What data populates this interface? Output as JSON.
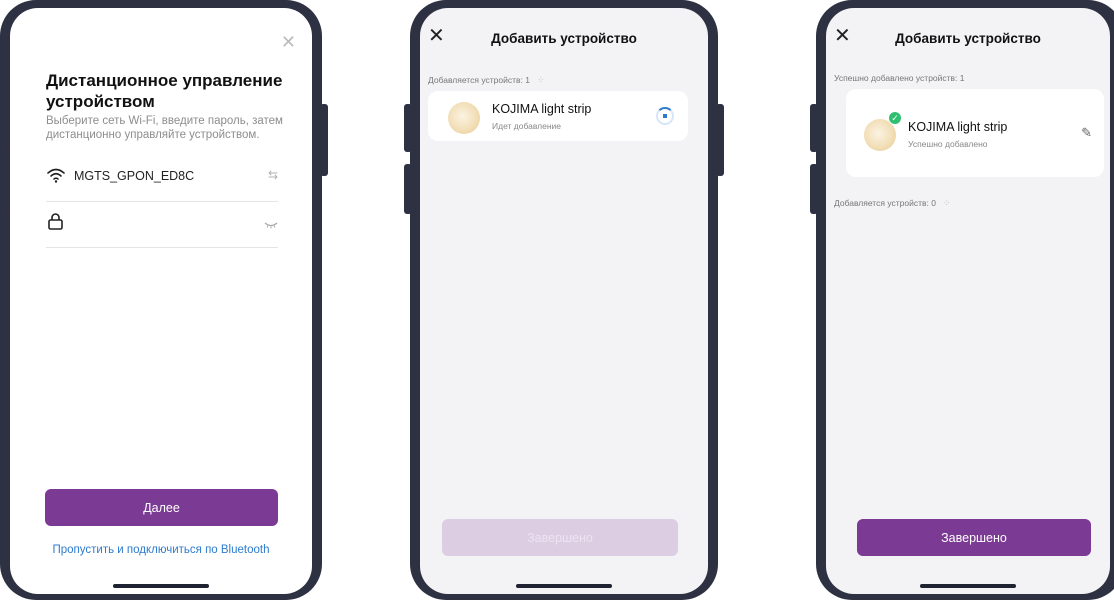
{
  "screen1": {
    "title": "Дистанционное управление устройством",
    "subtitle": "Выберите сеть Wi-Fi, введите пароль, затем дистанционно управляйте устройством.",
    "wifi_name": "MGTS_GPON_ED8C",
    "password": "",
    "next_label": "Далее",
    "bluetooth_link": "Пропустить и подключиться по Bluetooth"
  },
  "screen2": {
    "header_title": "Добавить устройство",
    "adding_label": "Добавляется устройств: 1",
    "device_name": "KOJIMA light strip",
    "device_status": "Идет добавление",
    "done_label": "Завершено"
  },
  "screen3": {
    "header_title": "Добавить устройство",
    "success_label": "Успешно добавлено устройств: 1",
    "device_name": "KOJIMA light strip",
    "device_status": "Успешно добавлено",
    "adding_label": "Добавляется устройств: 0",
    "done_label": "Завершено"
  },
  "icons": {
    "close": "close-icon",
    "wifi": "wifi-icon",
    "swap": "swap-icon",
    "lock": "lock-icon",
    "eye_closed": "eye-closed-icon",
    "spinner": "spinner-icon",
    "progress": "progress-icon",
    "check": "check-icon",
    "edit": "edit-icon"
  },
  "colors": {
    "primary": "#7b3a94",
    "primary_disabled": "#dccde3",
    "link": "#2d7bcf",
    "success": "#2fbf71",
    "phone_frame": "#2e3142"
  }
}
